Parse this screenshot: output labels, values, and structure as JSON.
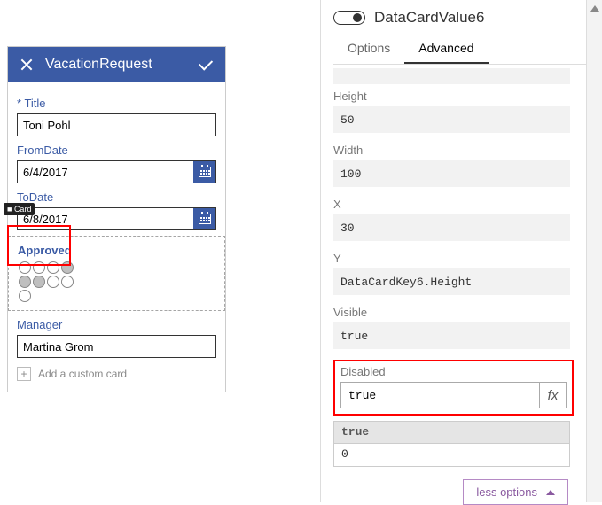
{
  "form": {
    "header_title": "VacationRequest",
    "tooltip": "Card",
    "title_label": "Title",
    "title_value": "Toni Pohl",
    "fromdate_label": "FromDate",
    "fromdate_value": "6/4/2017",
    "todate_label": "ToDate",
    "todate_value": "6/8/2017",
    "approved_label": "Approved",
    "manager_label": "Manager",
    "manager_value": "Martina Grom",
    "add_card_label": "Add a custom card"
  },
  "panel": {
    "title": "DataCardValue6",
    "tabs": {
      "options": "Options",
      "advanced": "Advanced"
    },
    "props": {
      "height_label": "Height",
      "height_value": "50",
      "width_label": "Width",
      "width_value": "100",
      "x_label": "X",
      "x_value": "30",
      "y_label": "Y",
      "y_value": "DataCardKey6.Height",
      "visible_label": "Visible",
      "visible_value": "true",
      "disabled_label": "Disabled",
      "disabled_value": "true",
      "fx_label": "fx",
      "result_type": "true",
      "result_value": "0"
    },
    "less_options": "less options"
  }
}
